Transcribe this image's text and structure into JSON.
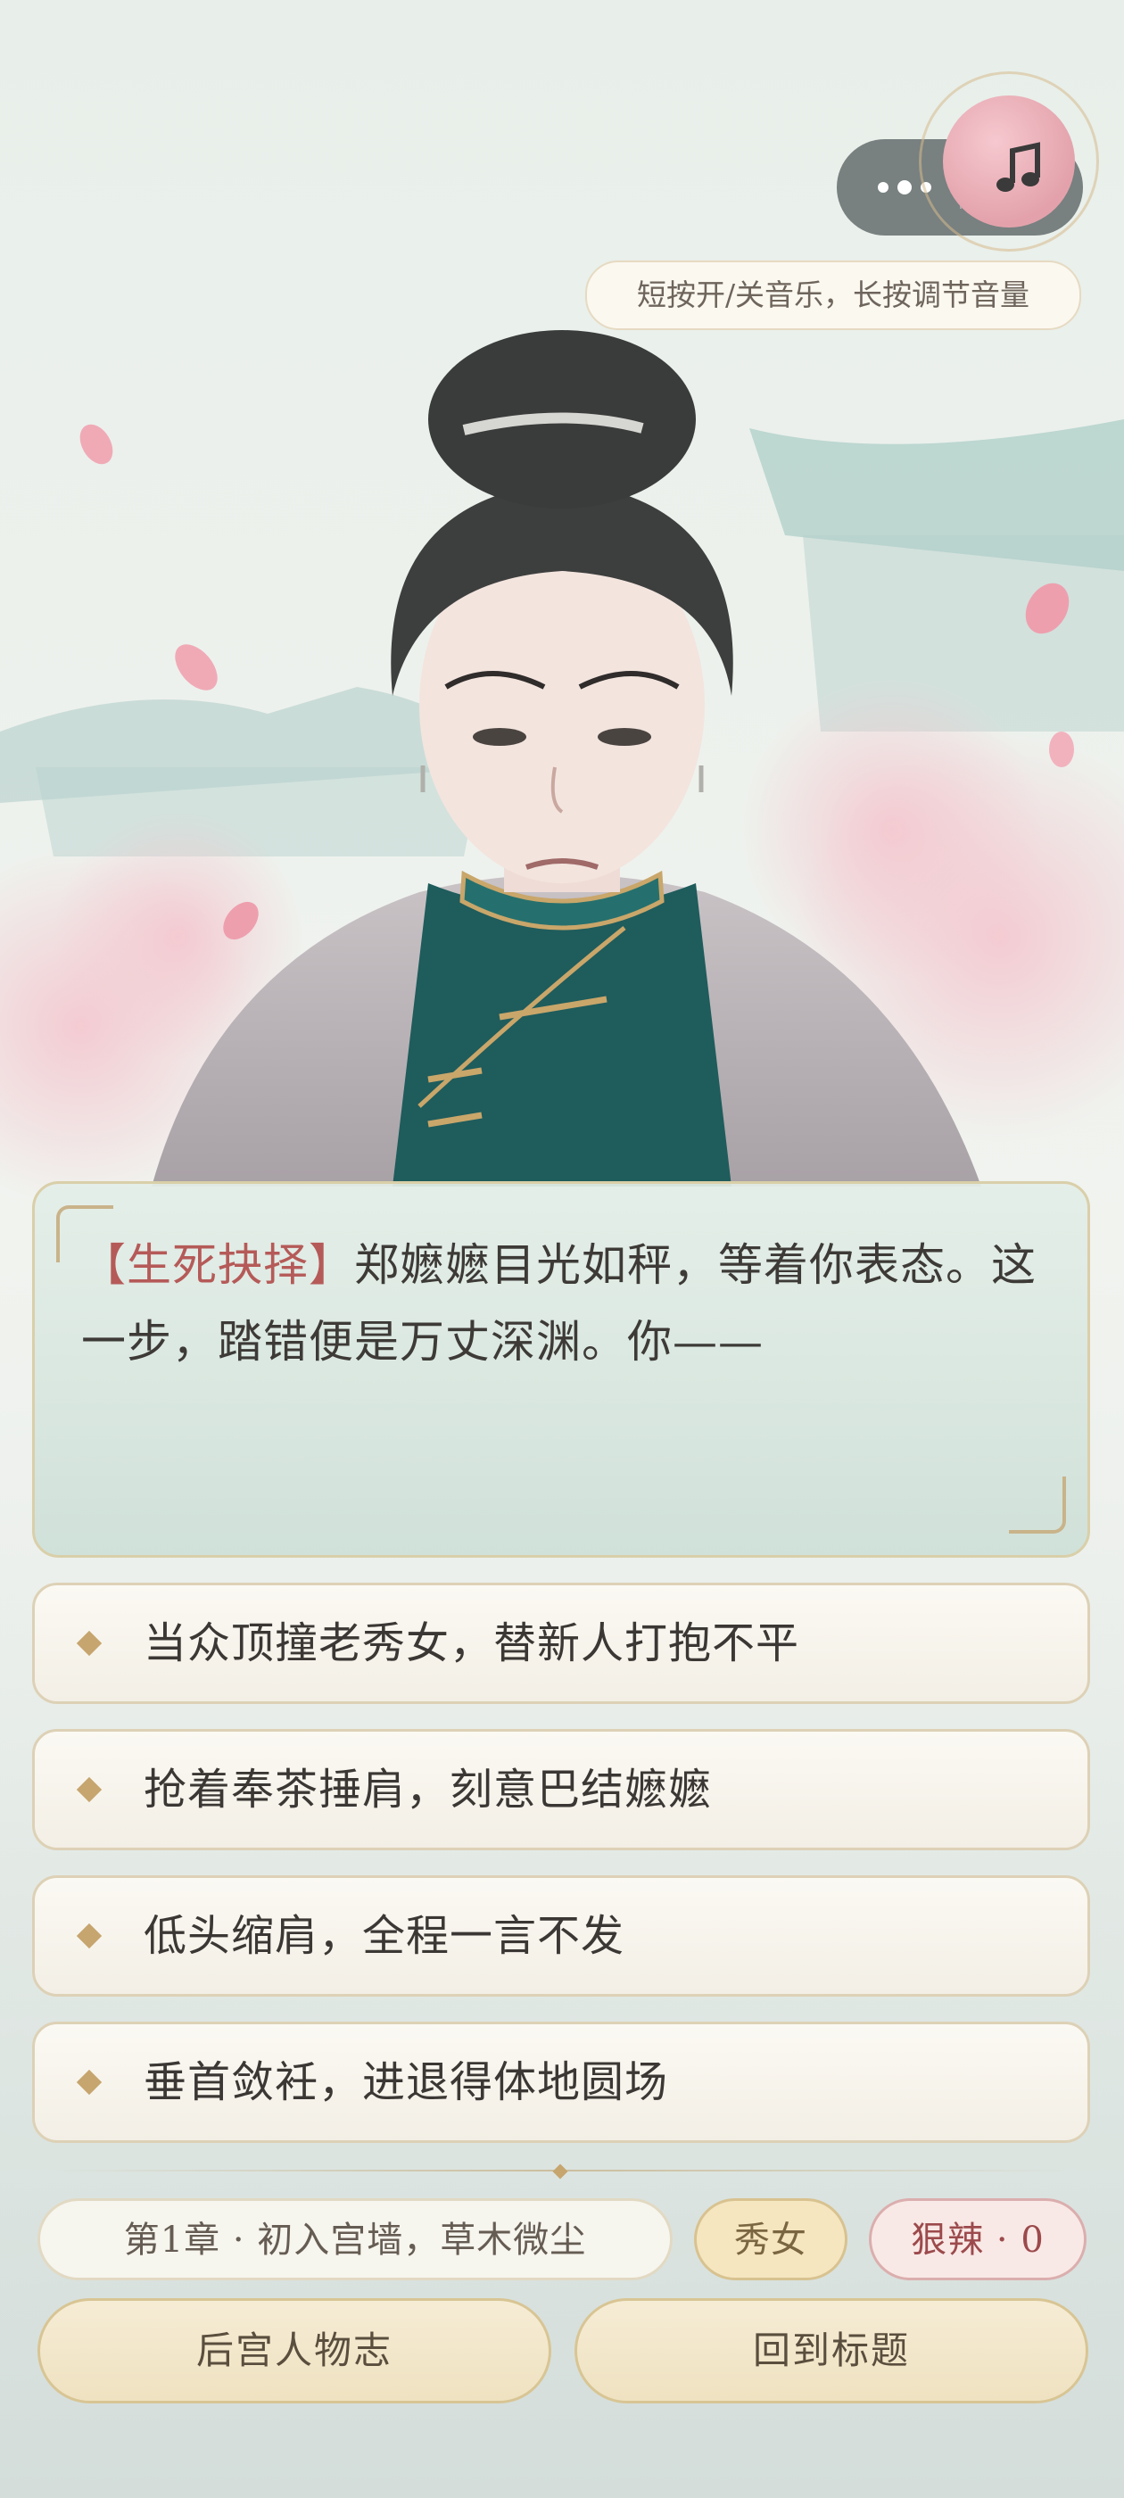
{
  "top_bar": {
    "menu_icon": "more-dots-icon",
    "close_icon": "target-circle-icon",
    "music_icon": "music-note-icon",
    "music_tip": "短按开/关音乐，长按调节音量"
  },
  "dialog": {
    "tag": "【生死抉择】",
    "text": "郑嬷嬷目光如秤，等着你表态。这一步，踏错便是万丈深渊。你——"
  },
  "choices": [
    {
      "label": "当众顶撞老秀女，替新人打抱不平"
    },
    {
      "label": "抢着奉茶捶肩，刻意巴结嬷嬷"
    },
    {
      "label": "低头缩肩，全程一言不发"
    },
    {
      "label": "垂首敛衽，进退得体地圆场"
    }
  ],
  "status": {
    "chapter": "第1章 · 初入宫墙，草木微尘",
    "role": "秀女",
    "stat": "狠辣 · 0"
  },
  "buttons": {
    "left": "后宫人物志",
    "right": "回到标题"
  },
  "colors": {
    "tag_red": "#b55a58",
    "accent_gold": "#c9a66a",
    "robe_teal": "#1f5c5c"
  }
}
